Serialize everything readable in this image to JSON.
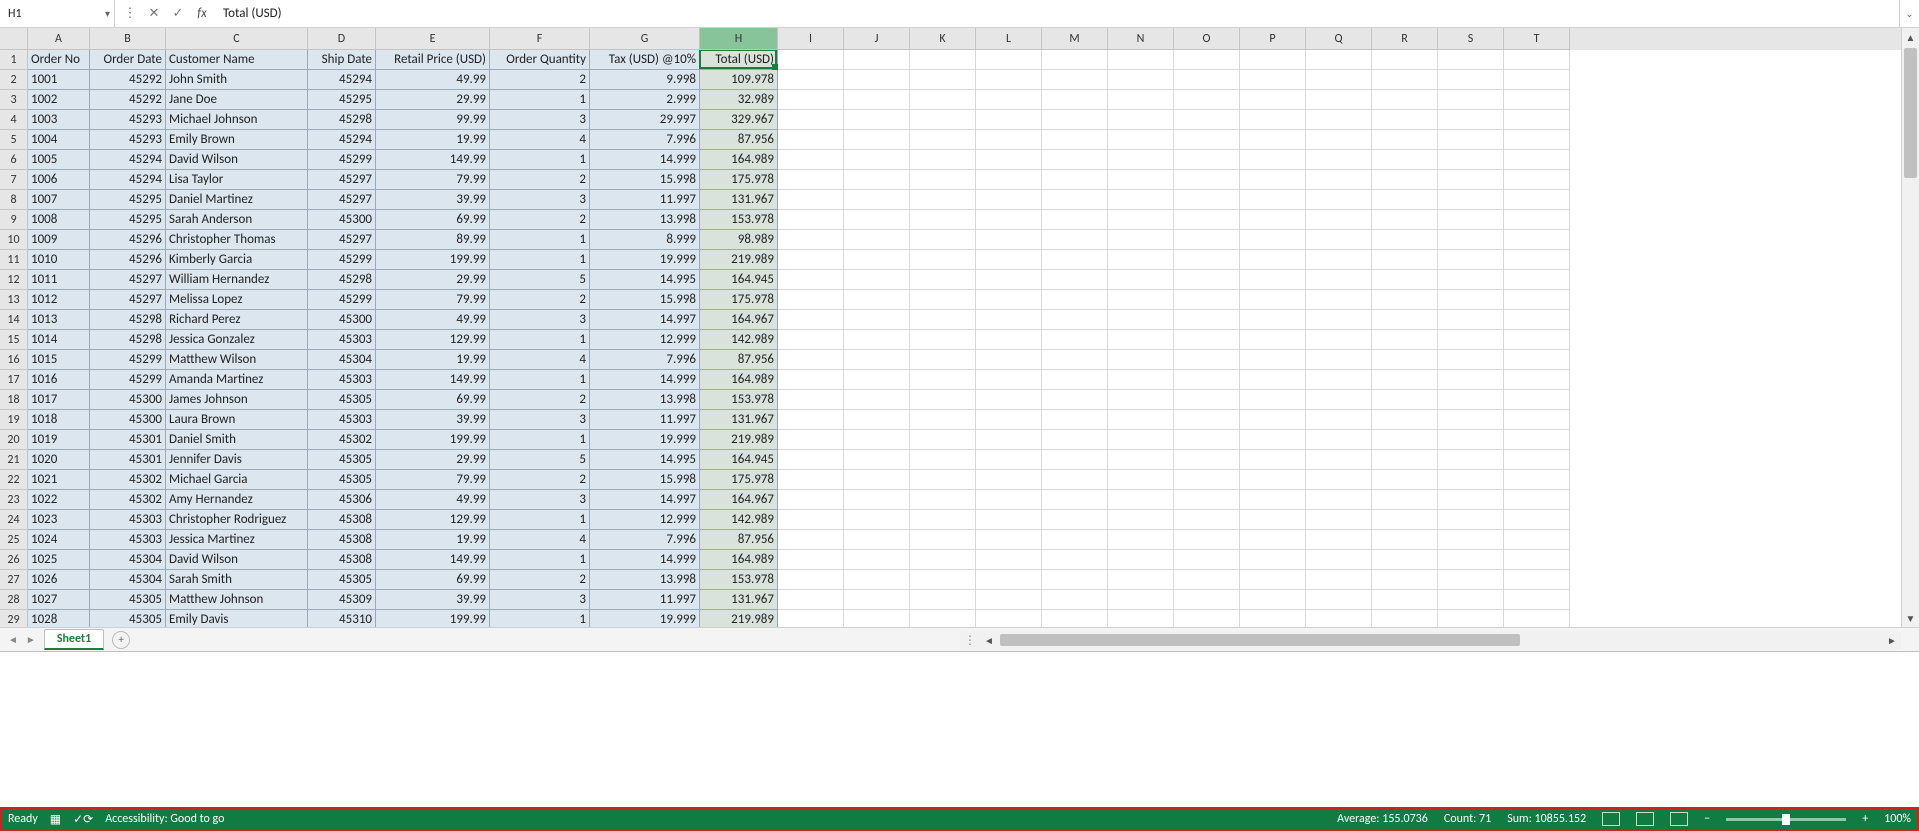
{
  "nameBox": "H1",
  "formula": "Total (USD)",
  "columns": [
    "A",
    "B",
    "C",
    "D",
    "E",
    "F",
    "G",
    "H",
    "I",
    "J",
    "K",
    "L",
    "M",
    "N",
    "O",
    "P",
    "Q",
    "R",
    "S",
    "T"
  ],
  "colWidths": {
    "A": "wA",
    "B": "wB",
    "C": "wC",
    "D": "wD",
    "E": "wE",
    "F": "wF",
    "G": "wG",
    "H": "wH"
  },
  "headers": [
    "Order No",
    "Order Date",
    "Customer Name",
    "Ship Date",
    "Retail Price (USD)",
    "Order Quantity",
    "Tax (USD) @10%",
    "Total (USD)"
  ],
  "rows": [
    [
      "1001",
      "45292",
      "John Smith",
      "45294",
      "49.99",
      "2",
      "9.998",
      "109.978"
    ],
    [
      "1002",
      "45292",
      "Jane Doe",
      "45295",
      "29.99",
      "1",
      "2.999",
      "32.989"
    ],
    [
      "1003",
      "45293",
      "Michael Johnson",
      "45298",
      "99.99",
      "3",
      "29.997",
      "329.967"
    ],
    [
      "1004",
      "45293",
      "Emily Brown",
      "45294",
      "19.99",
      "4",
      "7.996",
      "87.956"
    ],
    [
      "1005",
      "45294",
      "David Wilson",
      "45299",
      "149.99",
      "1",
      "14.999",
      "164.989"
    ],
    [
      "1006",
      "45294",
      "Lisa Taylor",
      "45297",
      "79.99",
      "2",
      "15.998",
      "175.978"
    ],
    [
      "1007",
      "45295",
      "Daniel Martinez",
      "45297",
      "39.99",
      "3",
      "11.997",
      "131.967"
    ],
    [
      "1008",
      "45295",
      "Sarah Anderson",
      "45300",
      "69.99",
      "2",
      "13.998",
      "153.978"
    ],
    [
      "1009",
      "45296",
      "Christopher Thomas",
      "45297",
      "89.99",
      "1",
      "8.999",
      "98.989"
    ],
    [
      "1010",
      "45296",
      "Kimberly Garcia",
      "45299",
      "199.99",
      "1",
      "19.999",
      "219.989"
    ],
    [
      "1011",
      "45297",
      "William Hernandez",
      "45298",
      "29.99",
      "5",
      "14.995",
      "164.945"
    ],
    [
      "1012",
      "45297",
      "Melissa Lopez",
      "45299",
      "79.99",
      "2",
      "15.998",
      "175.978"
    ],
    [
      "1013",
      "45298",
      "Richard Perez",
      "45300",
      "49.99",
      "3",
      "14.997",
      "164.967"
    ],
    [
      "1014",
      "45298",
      "Jessica Gonzalez",
      "45303",
      "129.99",
      "1",
      "12.999",
      "142.989"
    ],
    [
      "1015",
      "45299",
      "Matthew Wilson",
      "45304",
      "19.99",
      "4",
      "7.996",
      "87.956"
    ],
    [
      "1016",
      "45299",
      "Amanda Martinez",
      "45303",
      "149.99",
      "1",
      "14.999",
      "164.989"
    ],
    [
      "1017",
      "45300",
      "James Johnson",
      "45305",
      "69.99",
      "2",
      "13.998",
      "153.978"
    ],
    [
      "1018",
      "45300",
      "Laura Brown",
      "45303",
      "39.99",
      "3",
      "11.997",
      "131.967"
    ],
    [
      "1019",
      "45301",
      "Daniel Smith",
      "45302",
      "199.99",
      "1",
      "19.999",
      "219.989"
    ],
    [
      "1020",
      "45301",
      "Jennifer Davis",
      "45305",
      "29.99",
      "5",
      "14.995",
      "164.945"
    ],
    [
      "1021",
      "45302",
      "Michael Garcia",
      "45305",
      "79.99",
      "2",
      "15.998",
      "175.978"
    ],
    [
      "1022",
      "45302",
      "Amy Hernandez",
      "45306",
      "49.99",
      "3",
      "14.997",
      "164.967"
    ],
    [
      "1023",
      "45303",
      "Christopher Rodriguez",
      "45308",
      "129.99",
      "1",
      "12.999",
      "142.989"
    ],
    [
      "1024",
      "45303",
      "Jessica Martinez",
      "45308",
      "19.99",
      "4",
      "7.996",
      "87.956"
    ],
    [
      "1025",
      "45304",
      "David Wilson",
      "45308",
      "149.99",
      "1",
      "14.999",
      "164.989"
    ],
    [
      "1026",
      "45304",
      "Sarah Smith",
      "45305",
      "69.99",
      "2",
      "13.998",
      "153.978"
    ],
    [
      "1027",
      "45305",
      "Matthew Johnson",
      "45309",
      "39.99",
      "3",
      "11.997",
      "131.967"
    ],
    [
      "1028",
      "45305",
      "Emily Davis",
      "45310",
      "199.99",
      "1",
      "19.999",
      "219.989"
    ]
  ],
  "sheetTab": "Sheet1",
  "status": {
    "ready": "Ready",
    "accessibility": "Accessibility: Good to go",
    "average": "Average: 155.0736",
    "count": "Count: 71",
    "sum": "Sum: 10855.152",
    "zoom": "100%"
  },
  "selectedCell": {
    "row": 1,
    "col": "H"
  }
}
